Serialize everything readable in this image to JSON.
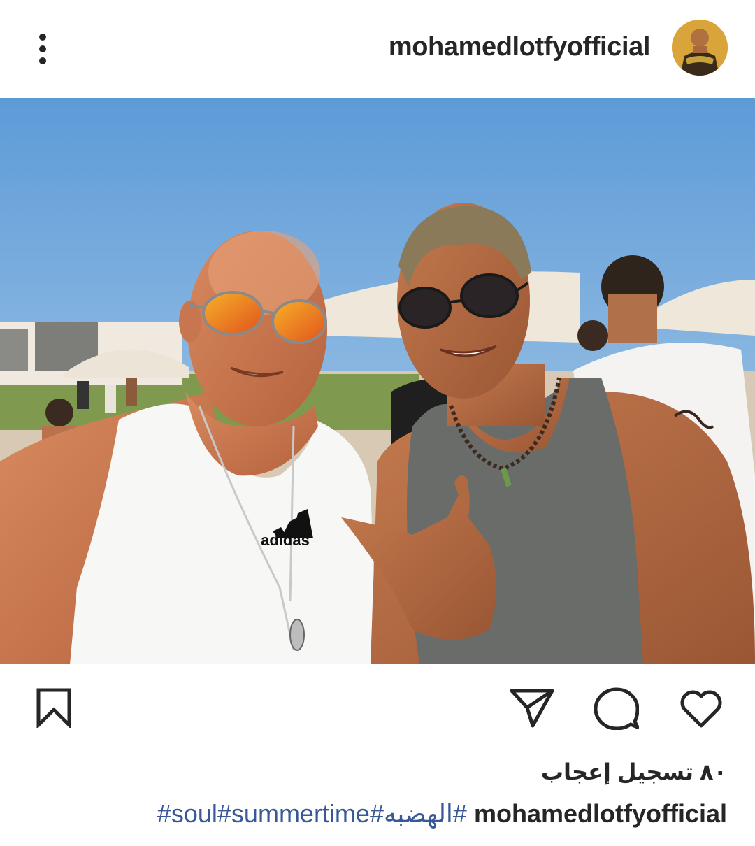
{
  "header": {
    "username": "mohamedlotfyofficial",
    "more_icon": "more-vertical-icon",
    "avatar_icon": "profile-avatar"
  },
  "post": {
    "image_logo_text": "adidas"
  },
  "actions": {
    "bookmark_icon": "bookmark-icon",
    "share_icon": "send-icon",
    "comment_icon": "comment-icon",
    "like_icon": "heart-icon"
  },
  "likes": {
    "text": "٨٠ تسجيل إعجاب"
  },
  "caption": {
    "username": "mohamedlotfyofficial",
    "hashtags": "#soul#summertime#الهضبه# "
  },
  "colors": {
    "text": "#262626",
    "hashtag": "#385898",
    "sky": "#6ea8df",
    "background": "#ffffff"
  }
}
